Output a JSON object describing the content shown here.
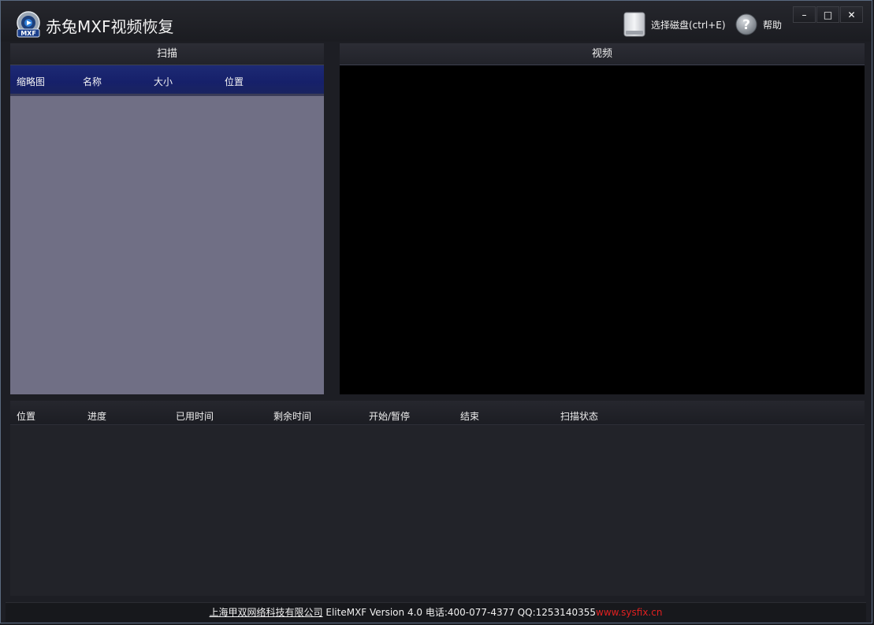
{
  "app": {
    "title": "赤兔MXF视频恢复",
    "logo_text": "MXF",
    "accent": "#16206a"
  },
  "toolbar": {
    "select_disk_label": "选择磁盘(ctrl+E)",
    "help_label": "帮助"
  },
  "window_controls": {
    "minimize": "–",
    "maximize": "□",
    "close": "✕"
  },
  "scan_panel": {
    "title": "扫描",
    "columns": [
      "缩略图",
      "名称",
      "大小",
      "位置"
    ]
  },
  "video_panel": {
    "title": "视频"
  },
  "task_table": {
    "columns": [
      "位置",
      "进度",
      "已用时间",
      "剩余时间",
      "开始/暂停",
      "结束",
      "扫描状态"
    ]
  },
  "footer": {
    "company": "上海甲双网络科技有限公司",
    "info": " EliteMXF Version 4.0 电话:400-077-4377 QQ:1253140355",
    "site": "www.sysfix.cn"
  },
  "icons": {
    "logo": "mxf-logo-icon",
    "disk": "disk-icon",
    "help": "help-icon"
  }
}
